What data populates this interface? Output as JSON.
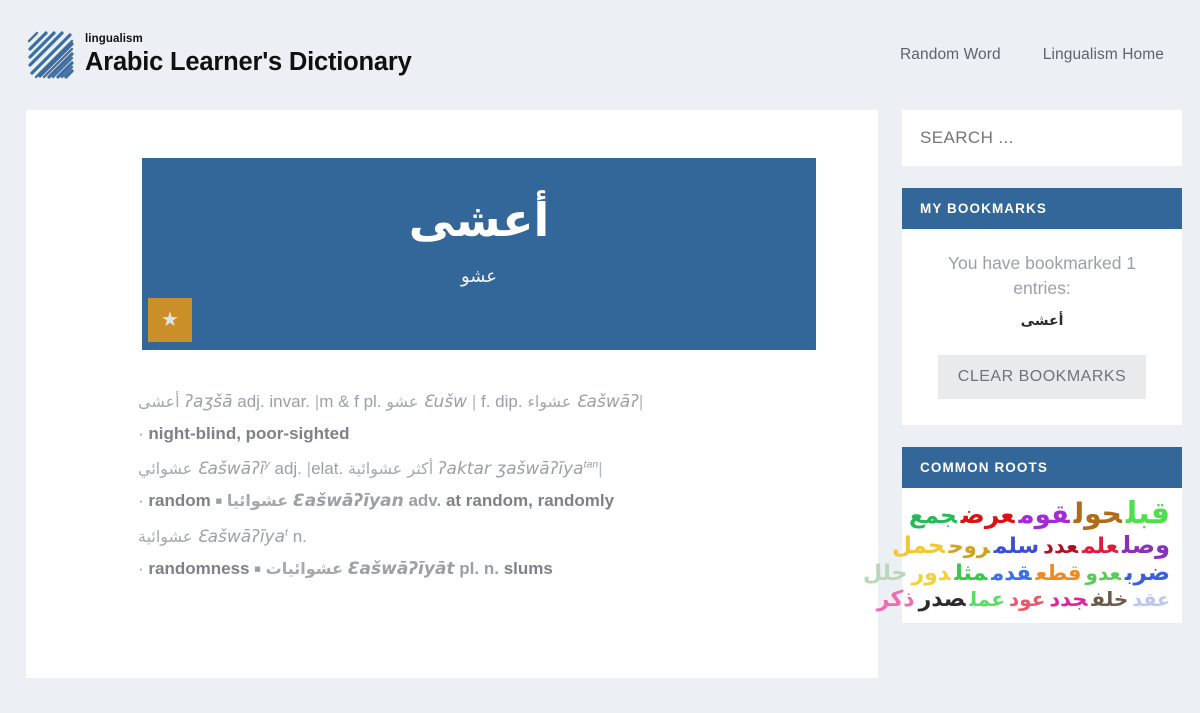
{
  "header": {
    "brand_sub": "lingualism",
    "brand_title": "Arabic Learner's Dictionary",
    "logo_icon": "scribble-square-logo",
    "nav": [
      {
        "label": "Random Word"
      },
      {
        "label": "Lingualism Home"
      }
    ]
  },
  "entry": {
    "headword": "أعشى",
    "root": "عشو",
    "bookmark_icon": "star-icon",
    "bookmark_glyph": "★",
    "definitions": [
      {
        "headline_ar": "أعشى",
        "headline_tr": "ʔaʒšā",
        "grammar": "adj. invar.",
        "forms": "|m & f pl. عشو ƐušwX| f. dip. عشواء ƐašwāʔX|",
        "forms_parts": [
          {
            "label": "m & f pl.",
            "ar": "عشو",
            "tr": "Ɛušw"
          },
          {
            "label": "f. dip.",
            "ar": "عشواء",
            "tr": "Ɛašwāʔ"
          }
        ],
        "senses": "night-blind, poor-sighted"
      },
      {
        "headline_ar": "عشوائي",
        "headline_tr": "Ɛašwāʔī",
        "headline_sup": "y",
        "grammar": "adj.",
        "forms_parts": [
          {
            "label": "elat.",
            "ar": "أكثر عشوائية",
            "tr": "ʔaktar ʒašwāʔīya",
            "sup": "tan"
          }
        ],
        "senses": "random",
        "sub": {
          "ar": "عشوائيا",
          "tr": "Ɛašwāʔīyan",
          "grammar": "adv.",
          "gloss": "at random, randomly"
        }
      },
      {
        "headline_ar": "عشوائية",
        "headline_tr": "Ɛašwāʔīya",
        "headline_sup": "t",
        "grammar": "n.",
        "senses": "randomness",
        "sub": {
          "ar": "عشوائيات",
          "tr": "Ɛašwāʔīyāt",
          "grammar": "pl. n.",
          "gloss": "slums"
        }
      }
    ]
  },
  "sidebar": {
    "search_placeholder": "SEARCH ...",
    "bookmarks": {
      "title": "MY BOOKMARKS",
      "message": "You have bookmarked 1 entries:",
      "entries": [
        "أعشى"
      ],
      "clear_label": "CLEAR BOOKMARKS"
    },
    "common_roots": {
      "title": "COMMON ROOTS",
      "rows": [
        [
          {
            "text": "قبل",
            "color": "#4ce04c",
            "size": 30
          },
          {
            "text": "حول",
            "color": "#b06a18",
            "size": 28
          },
          {
            "text": "قوم",
            "color": "#a42ad8",
            "size": 26
          },
          {
            "text": "عرض",
            "color": "#dd1111",
            "size": 25
          },
          {
            "text": "جمع",
            "color": "#22bb55",
            "size": 23
          }
        ],
        [
          {
            "text": "وصل",
            "color": "#8b2fbf",
            "size": 24
          },
          {
            "text": "علم",
            "color": "#e01b3c",
            "size": 22
          },
          {
            "text": "عدد",
            "color": "#b01020",
            "size": 21
          },
          {
            "text": "سلم",
            "color": "#3b4fd8",
            "size": 22
          },
          {
            "text": "روح",
            "color": "#d0a11a",
            "size": 21
          },
          {
            "text": "حمل",
            "color": "#f2c733",
            "size": 23
          }
        ],
        [
          {
            "text": "ضرب",
            "color": "#3a5fe0",
            "size": 23
          },
          {
            "text": "عدو",
            "color": "#55cc55",
            "size": 20
          },
          {
            "text": "قطع",
            "color": "#f08a20",
            "size": 21
          },
          {
            "text": "قدم",
            "color": "#3a6fe8",
            "size": 21
          },
          {
            "text": "مثل",
            "color": "#33cc44",
            "size": 22
          },
          {
            "text": "دور",
            "color": "#f2d23a",
            "size": 22
          },
          {
            "text": "حلل",
            "color": "#b8d8b8",
            "size": 22
          }
        ],
        [
          {
            "text": "عقد",
            "color": "#b9c7ea",
            "size": 19
          },
          {
            "text": "خلف",
            "color": "#6b5a4a",
            "size": 20
          },
          {
            "text": "جدد",
            "color": "#e0249a",
            "size": 21
          },
          {
            "text": "عود",
            "color": "#ee5566",
            "size": 20
          },
          {
            "text": "عمل",
            "color": "#55dd66",
            "size": 20
          },
          {
            "text": "صدر",
            "color": "#2b2b2b",
            "size": 22
          },
          {
            "text": "ذكر",
            "color": "#f06bb0",
            "size": 22
          }
        ]
      ]
    }
  },
  "colors": {
    "page_bg": "#eceff3",
    "accent_blue": "#336699",
    "gold": "#ca8f28",
    "card_white": "#ffffff",
    "muted_text": "#9aa0a6"
  }
}
